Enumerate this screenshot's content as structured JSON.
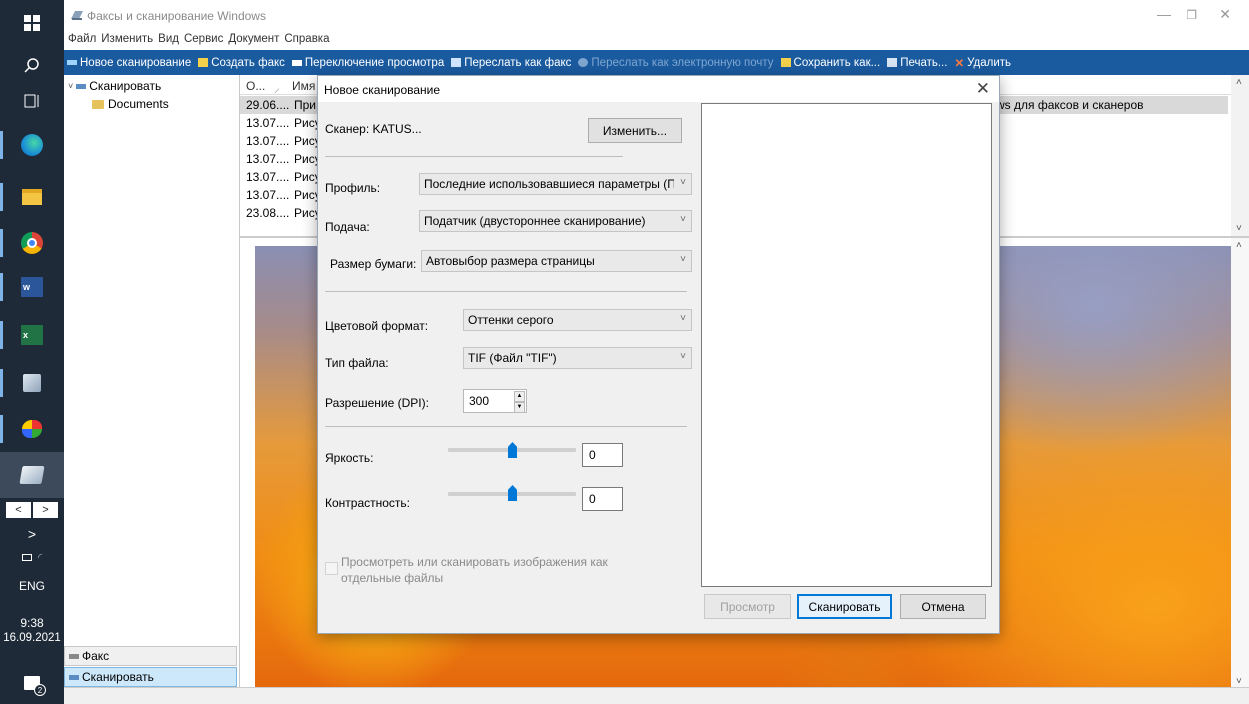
{
  "window": {
    "title": "Факсы и сканирование Windows",
    "menu": [
      "Файл",
      "Изменить",
      "Вид",
      "Сервис",
      "Документ",
      "Справка"
    ],
    "minimize": "—",
    "restore": "❐",
    "close": "✕"
  },
  "toolbar": [
    {
      "label": "Новое сканирование",
      "enabled": true,
      "icon": "scan-icon",
      "color": "#9fd3ff"
    },
    {
      "label": "Создать факс",
      "enabled": true,
      "icon": "fax-icon",
      "color": "#f5d04b"
    },
    {
      "label": "Переключение просмотра",
      "enabled": true,
      "icon": "view-icon",
      "color": "#ffffff"
    },
    {
      "label": "Переслать как факс",
      "enabled": true,
      "icon": "forward-fax-icon",
      "color": "#cfe5ff"
    },
    {
      "label": "Переслать как электронную почту",
      "enabled": false,
      "icon": "email-icon",
      "color": "#7fa6cf"
    },
    {
      "label": "Сохранить как...",
      "enabled": true,
      "icon": "save-icon",
      "color": "#f5d04b"
    },
    {
      "label": "Печать...",
      "enabled": true,
      "icon": "print-icon",
      "color": "#d7e4f2"
    },
    {
      "label": "Удалить",
      "enabled": true,
      "icon": "delete-icon",
      "color": "#ff7a3c"
    }
  ],
  "tree": {
    "root": "Сканировать",
    "child": "Documents"
  },
  "nav_buttons": [
    "Факс",
    "Сканировать"
  ],
  "list": {
    "headers": {
      "col1": "О...",
      "col2": "Имя"
    },
    "rows": [
      {
        "date": "29.06....",
        "name": "При"
      },
      {
        "date": "13.07....",
        "name": "Рису"
      },
      {
        "date": "13.07....",
        "name": "Рису"
      },
      {
        "date": "13.07....",
        "name": "Рису"
      },
      {
        "date": "13.07....",
        "name": "Рису"
      },
      {
        "date": "13.07....",
        "name": "Рису"
      },
      {
        "date": "23.08....",
        "name": "Рису"
      }
    ],
    "selected_tail": "ws для факсов и сканеров"
  },
  "taskbar": {
    "lang": "ENG",
    "time": "9:38",
    "date": "16.09.2021",
    "notifications": "2",
    "prev": "<",
    "next": ">",
    "expand": ">"
  },
  "dialog": {
    "title": "Новое сканирование",
    "close": "✕",
    "scanner_label": "Сканер: KATUS...",
    "change_button": "Изменить...",
    "profile_label": "Профиль:",
    "profile_value": "Последние использовавшиеся параметры (По",
    "source_label": "Подача:",
    "source_value": "Податчик (двустороннее сканирование)",
    "paper_label": "Размер бумаги:",
    "paper_value": "Автовыбор размера страницы",
    "color_label": "Цветовой формат:",
    "color_value": "Оттенки серого",
    "filetype_label": "Тип файла:",
    "filetype_value": "TIF (Файл \"TIF\")",
    "dpi_label": "Разрешение (DPI):",
    "dpi_value": "300",
    "brightness_label": "Яркость:",
    "brightness_value": "0",
    "brightness_level": 0.5,
    "contrast_label": "Контрастность:",
    "contrast_value": "0",
    "contrast_level": 0.5,
    "separate_files_label": "Просмотреть или сканировать изображения как отдельные файлы",
    "preview_button": "Просмотр",
    "scan_button": "Сканировать",
    "cancel_button": "Отмена",
    "accent": "#0078d7"
  }
}
